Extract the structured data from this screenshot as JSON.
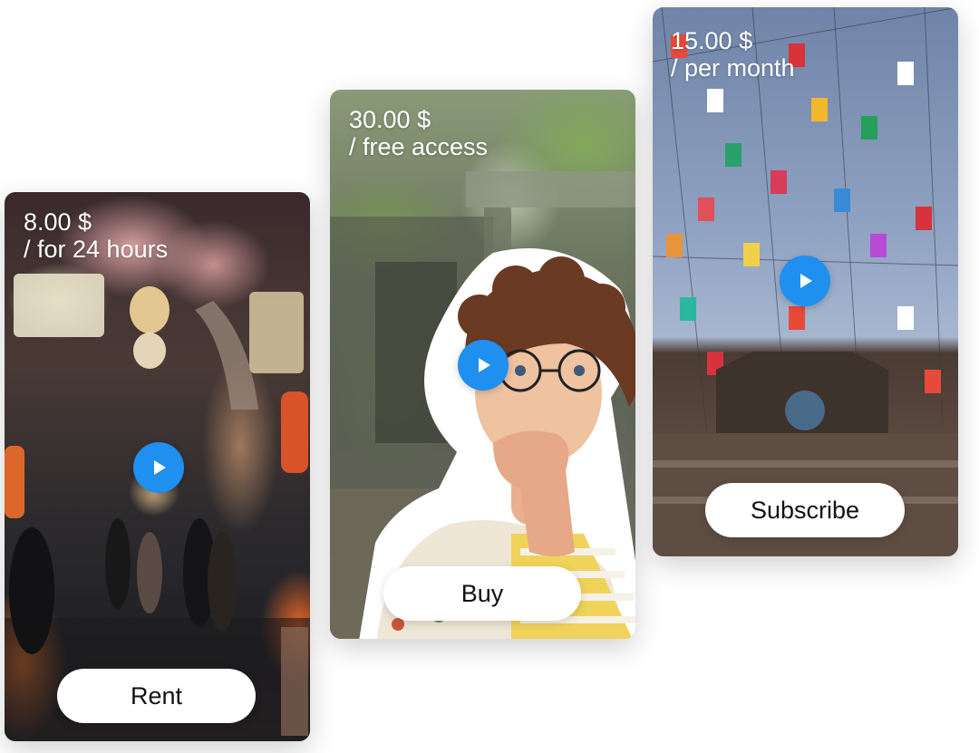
{
  "colors": {
    "play_accent": "#1f8ff0",
    "button_bg": "#ffffff",
    "button_text": "#111111",
    "price_text": "#ffffff"
  },
  "cards": [
    {
      "price": "8.00 $",
      "period": "/ for 24 hours",
      "button_label": "Rent",
      "image": "night-alley-photo"
    },
    {
      "price": "30.00 $",
      "period": "/ free access",
      "button_label": "Buy",
      "image": "temple-ruins-with-surprised-man-photo"
    },
    {
      "price": "15.00 $",
      "period": "/ per month",
      "button_label": "Subscribe",
      "image": "colorful-flags-over-building-photo"
    }
  ],
  "icons": {
    "play": "play-icon"
  }
}
